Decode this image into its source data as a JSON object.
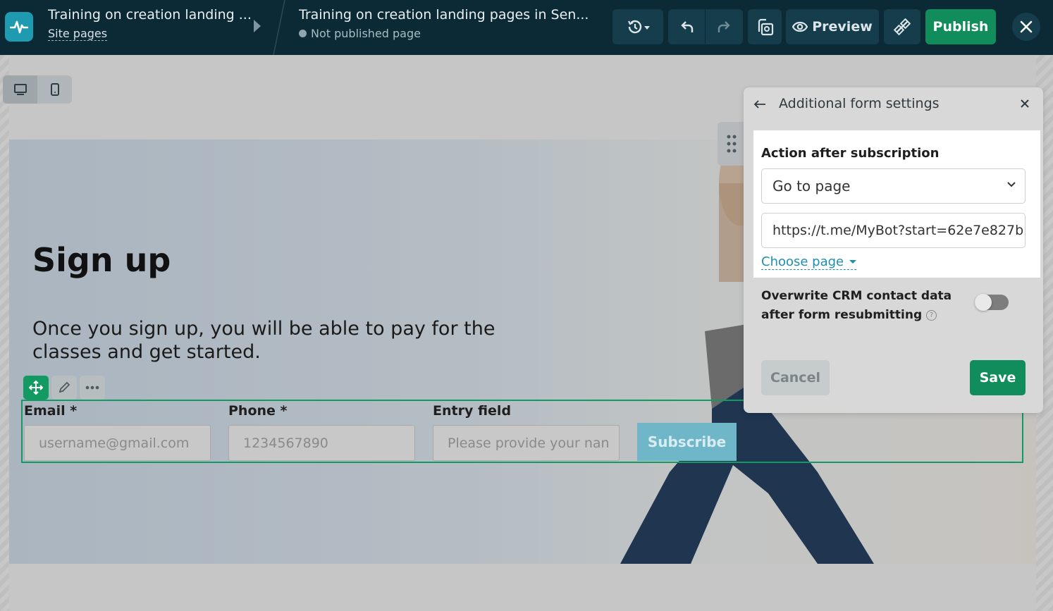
{
  "topbar": {
    "site_title": "Training on creation landing ...",
    "site_pages_link": "Site pages",
    "page_title": "Training on creation landing pages in Sen...",
    "page_status": "Not published page",
    "preview_label": "Preview",
    "publish_label": "Publish",
    "colors": {
      "bar": "#0c2a36",
      "publish": "#118c5b",
      "logo": "#1e9bb0"
    }
  },
  "canvas": {
    "heading": "Sign up",
    "description": "Once you sign up, you will be able to pay for the classes and get started.",
    "form": {
      "fields": [
        {
          "label": "Email *",
          "placeholder": "username@gmail.com"
        },
        {
          "label": "Phone *",
          "placeholder": "1234567890"
        },
        {
          "label": "Entry field",
          "placeholder": "Please provide your nan"
        }
      ],
      "submit_label": "Subscribe"
    }
  },
  "panel": {
    "title": "Additional form settings",
    "action_label": "Action after subscription",
    "action_selected": "Go to page",
    "url_value": "https://t.me/MyBot?start=62e7e827b",
    "choose_page_label": "Choose page",
    "overwrite_label": "Overwrite CRM contact data after form resubmitting",
    "overwrite_enabled": false,
    "cancel_label": "Cancel",
    "save_label": "Save"
  }
}
